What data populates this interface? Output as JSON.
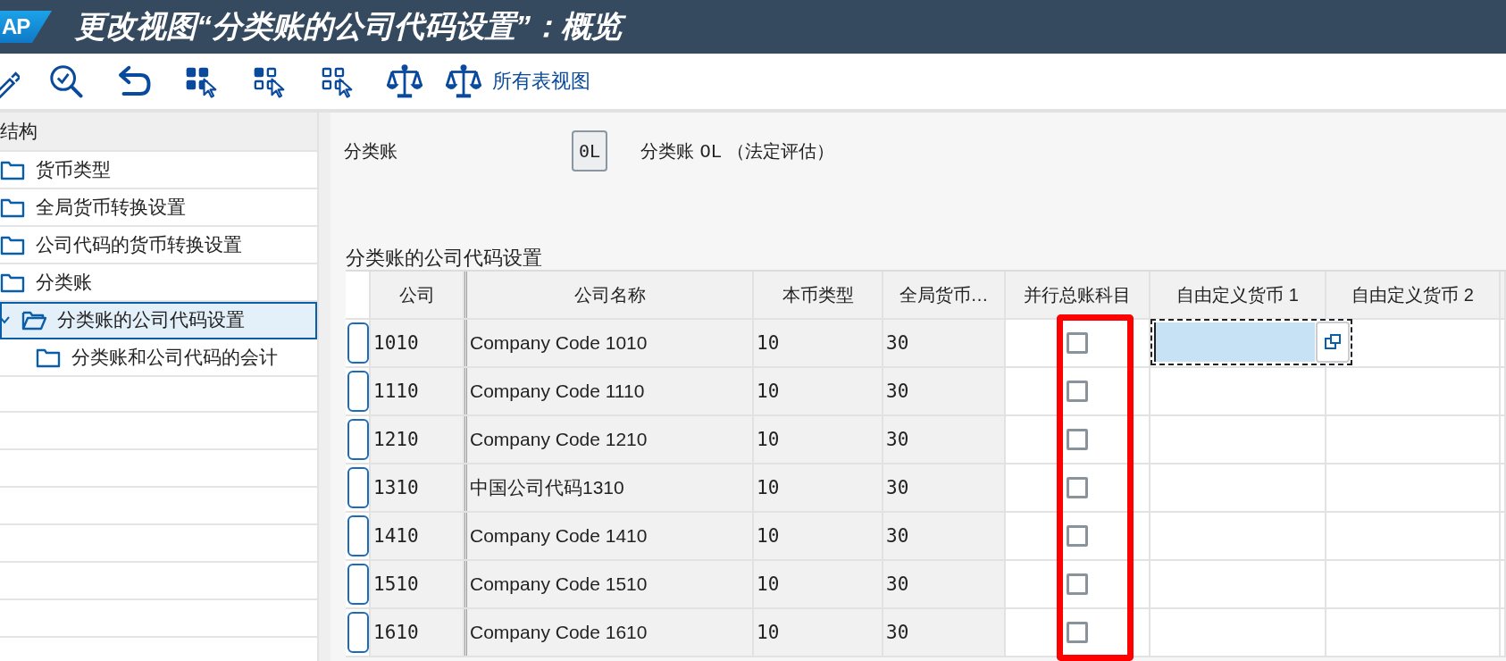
{
  "window": {
    "logo": "AP",
    "title": "更改视图“分类账的公司代码设置”：概览"
  },
  "toolbar": {
    "buttons": [
      {
        "label": "所有表视图"
      }
    ]
  },
  "tree": {
    "header": "结构",
    "items": [
      {
        "label": "货币类型",
        "selected": false,
        "expanded": false
      },
      {
        "label": "全局货币转换设置",
        "selected": false,
        "expanded": false
      },
      {
        "label": "公司代码的货币转换设置",
        "selected": false,
        "expanded": false
      },
      {
        "label": "分类账",
        "selected": false,
        "expanded": false
      },
      {
        "label": "分类账的公司代码设置",
        "selected": true,
        "expanded": true,
        "children": [
          {
            "label": "分类账和公司代码的会计",
            "selected": false,
            "expanded": false
          }
        ]
      }
    ]
  },
  "ledger": {
    "label": "分类账",
    "value": "0L",
    "description": "分类账 0L （法定评估）"
  },
  "table": {
    "title": "分类账的公司代码设置",
    "columns": [
      "公司",
      "公司名称",
      "本币类型",
      "全局货币…",
      "并行总账科目",
      "自由定义货币 1",
      "自由定义货币 2"
    ],
    "rows": [
      {
        "code": "1010",
        "name": "Company Code 1010",
        "local_currency_type": "10",
        "global_currency_type": "30",
        "parallel_gl": false,
        "highlighted": true,
        "focused": true
      },
      {
        "code": "1110",
        "name": "Company Code 1110",
        "local_currency_type": "10",
        "global_currency_type": "30",
        "parallel_gl": false,
        "highlighted": true,
        "focused": false
      },
      {
        "code": "1210",
        "name": "Company Code 1210",
        "local_currency_type": "10",
        "global_currency_type": "30",
        "parallel_gl": false,
        "highlighted": true,
        "focused": false
      },
      {
        "code": "1310",
        "name": "中国公司代码1310",
        "local_currency_type": "10",
        "global_currency_type": "30",
        "parallel_gl": false,
        "highlighted": true,
        "focused": false
      },
      {
        "code": "1410",
        "name": "Company Code 1410",
        "local_currency_type": "10",
        "global_currency_type": "30",
        "parallel_gl": false,
        "highlighted": true,
        "focused": false
      },
      {
        "code": "1510",
        "name": "Company Code 1510",
        "local_currency_type": "10",
        "global_currency_type": "30",
        "parallel_gl": false,
        "highlighted": true,
        "focused": false
      },
      {
        "code": "1610",
        "name": "Company Code 1610",
        "local_currency_type": "10",
        "global_currency_type": "30",
        "parallel_gl": false,
        "highlighted": true,
        "focused": false
      }
    ]
  }
}
